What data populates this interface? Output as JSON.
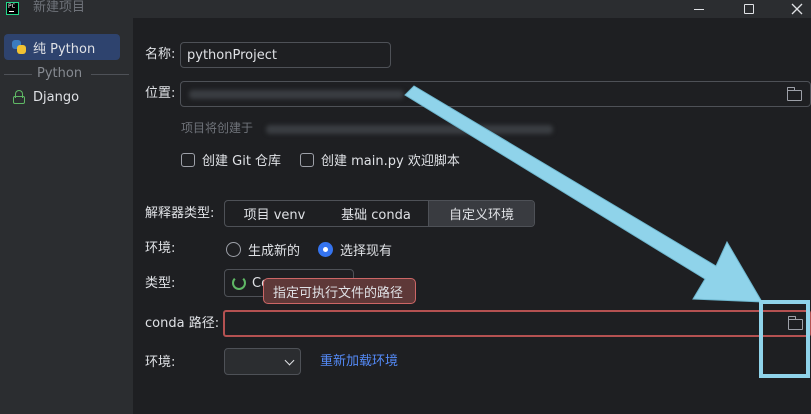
{
  "window": {
    "title": "新建项目"
  },
  "sidebar": {
    "items": [
      {
        "label": "纯 Python",
        "icon": "python-icon"
      },
      {
        "label": "Django",
        "icon": "django-lock-icon"
      }
    ],
    "separator_label": "Python"
  },
  "form": {
    "name_label": "名称:",
    "name_value": "pythonProject",
    "location_label": "位置:",
    "create_hint": "项目将创建于",
    "git_checkbox_label": "创建 Git 仓库",
    "main_checkbox_label": "创建 main.py 欢迎脚本",
    "interpreter_label": "解释器类型:",
    "interpreter_tabs": [
      "项目 venv",
      "基础 conda",
      "自定义环境"
    ],
    "env_label": "环境:",
    "radio_new": "生成新的",
    "radio_existing": "选择现有",
    "type_label": "类型:",
    "type_value": "Co",
    "tooltip": "指定可执行文件的路径",
    "conda_path_label": "conda 路径:",
    "env2_label": "环境:",
    "reload_link": "重新加载环境"
  },
  "colors": {
    "accent": "#3574f0",
    "error_border": "#b45151",
    "annotation_cyan": "#8fd3ea"
  }
}
